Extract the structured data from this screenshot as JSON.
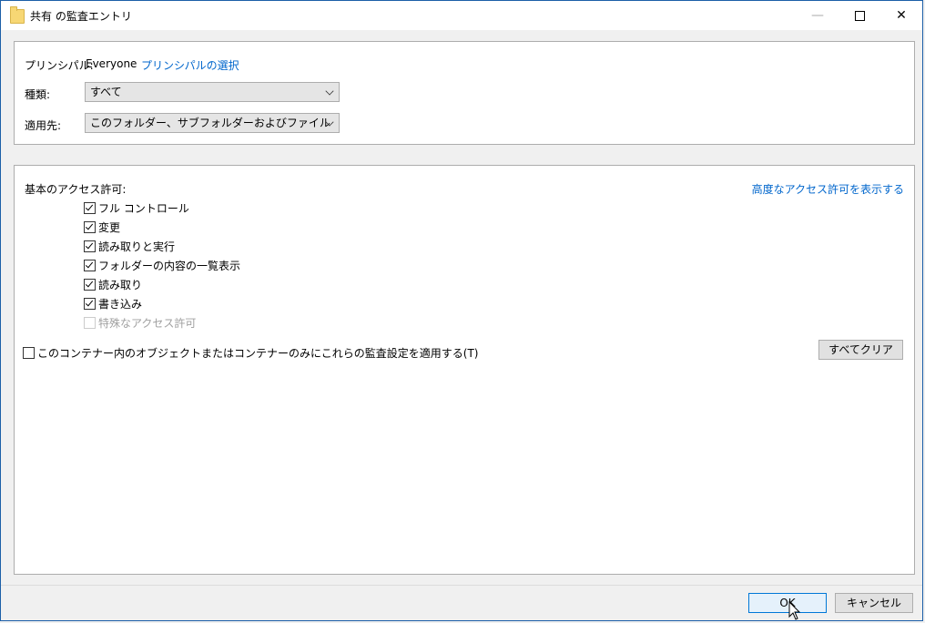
{
  "window": {
    "title": "共有 の監査エントリ",
    "controls": {
      "minimize": "—",
      "close": "✕"
    }
  },
  "principal": {
    "label": "プリンシパル:",
    "value": "Everyone",
    "select_link": "プリンシパルの選択"
  },
  "type": {
    "label": "種類:",
    "selected": "すべて"
  },
  "applies_to": {
    "label": "適用先:",
    "selected": "このフォルダー、サブフォルダーおよびファイル"
  },
  "permissions": {
    "heading": "基本のアクセス許可:",
    "advanced_link": "高度なアクセス許可を表示する",
    "items": [
      {
        "label": "フル コントロール",
        "checked": true,
        "disabled": false
      },
      {
        "label": "変更",
        "checked": true,
        "disabled": false
      },
      {
        "label": "読み取りと実行",
        "checked": true,
        "disabled": false
      },
      {
        "label": "フォルダーの内容の一覧表示",
        "checked": true,
        "disabled": false
      },
      {
        "label": "読み取り",
        "checked": true,
        "disabled": false
      },
      {
        "label": "書き込み",
        "checked": true,
        "disabled": false
      },
      {
        "label": "特殊なアクセス許可",
        "checked": false,
        "disabled": true
      }
    ],
    "apply_inside_label": "このコンテナー内のオブジェクトまたはコンテナーのみにこれらの監査設定を適用する(T)",
    "apply_inside_checked": false,
    "clear_all": "すべてクリア"
  },
  "footer": {
    "ok": "OK",
    "cancel": "キャンセル"
  }
}
